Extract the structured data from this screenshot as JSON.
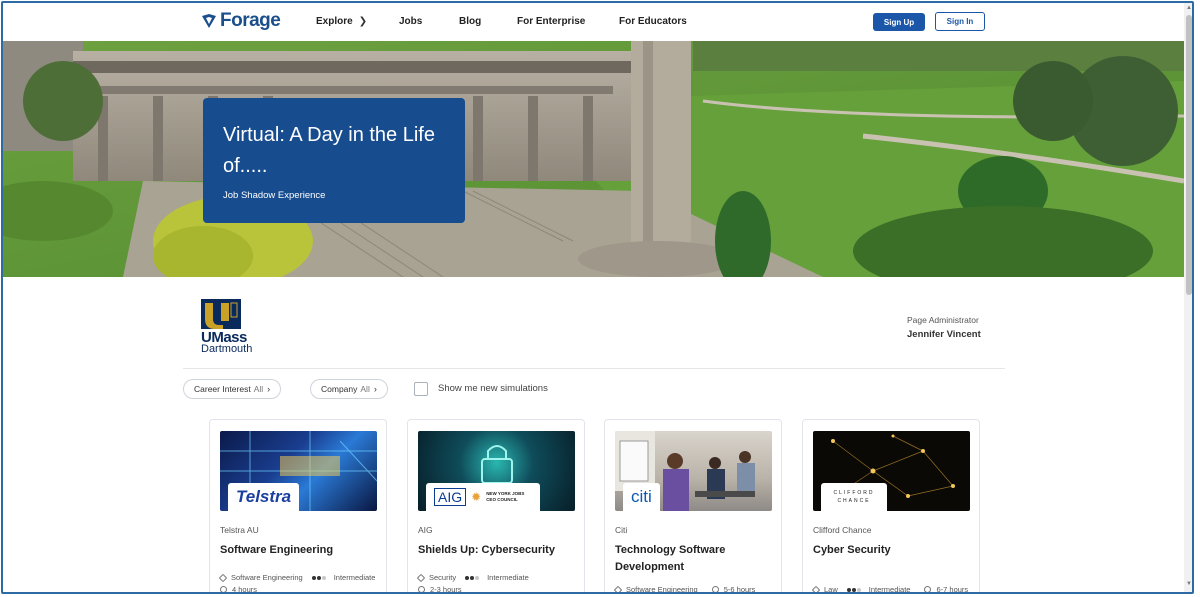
{
  "nav": {
    "brand": "Forage",
    "links": [
      {
        "label": "Explore",
        "has_chevron": true
      },
      {
        "label": "Jobs"
      },
      {
        "label": "Blog"
      },
      {
        "label": "For Enterprise"
      },
      {
        "label": "For Educators"
      }
    ],
    "signup_label": "Sign Up",
    "signin_label": "Sign In"
  },
  "hero": {
    "title": "Virtual: A Day in the Life of.....",
    "subtitle": "Job Shadow Experience"
  },
  "org": {
    "logo_text_main": "UMass",
    "logo_text_sub": "Dartmouth",
    "admin_label": "Page Administrator",
    "admin_name": "Jennifer Vincent"
  },
  "filters": {
    "career_interest_label": "Career Interest",
    "career_interest_value": "All",
    "company_label": "Company",
    "company_value": "All",
    "new_sims_label": "Show me new simulations"
  },
  "cards": [
    {
      "company": "Telstra AU",
      "logo_text": "Telstra",
      "title": "Software Engineering",
      "category": "Software Engineering",
      "level": "Intermediate",
      "level_dots": 2,
      "duration": "4 hours"
    },
    {
      "company": "AIG",
      "logo_text": "AIG",
      "logo_partner": "NEW YORK JOBS CEO COUNCIL",
      "title": "Shields Up: Cybersecurity",
      "category": "Security",
      "level": "Intermediate",
      "level_dots": 2,
      "duration": "2-3 hours"
    },
    {
      "company": "Citi",
      "logo_text": "citi",
      "title": "Technology Software Development",
      "category": "Software Engineering",
      "duration": "5-6 hours"
    },
    {
      "company": "Clifford Chance",
      "logo_text": "CLIFFORD CHANCE",
      "title": "Cyber Security",
      "category": "Law",
      "level": "Intermediate",
      "level_dots": 2,
      "duration": "6-7 hours"
    }
  ],
  "colors": {
    "brand": "#1b4f8c",
    "primary_button": "#1b56a8",
    "hero_card": "#174c8f"
  }
}
